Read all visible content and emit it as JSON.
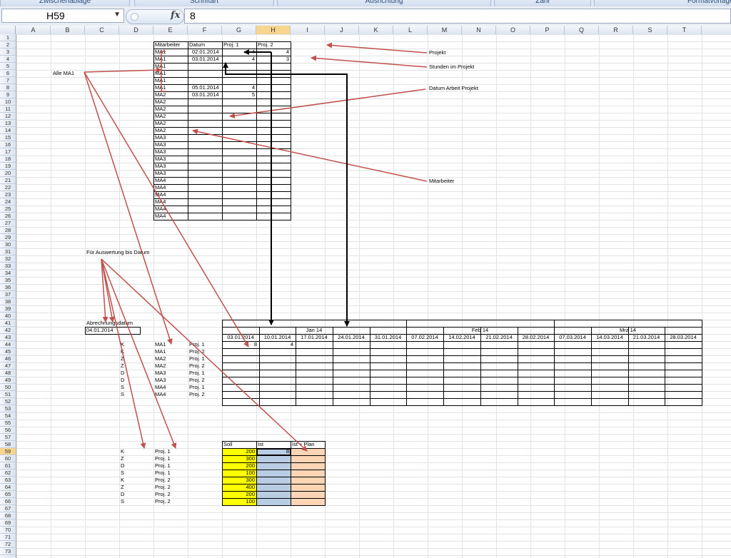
{
  "ribbon": {
    "groups": [
      "Zwischenablage",
      "Schriftart",
      "Ausrichtung",
      "Zahl",
      "Formatvorlagen"
    ]
  },
  "formula_bar": {
    "name_box": "H59",
    "fx_label": "fx",
    "value": "8"
  },
  "columns": [
    "A",
    "B",
    "C",
    "D",
    "E",
    "F",
    "G",
    "H",
    "I",
    "J",
    "K",
    "L",
    "M",
    "N",
    "O",
    "P",
    "Q",
    "R",
    "S",
    "T"
  ],
  "active_column": "H",
  "active_row": 59,
  "rows": 73,
  "top_table": {
    "headers": [
      "Mitarbeiter",
      "Datum",
      "Proj. 1",
      "Proj. 2"
    ],
    "rows": [
      [
        "MA1",
        "02.01.2014",
        "4",
        "4"
      ],
      [
        "MA1",
        "03.01.2014",
        "4",
        "3"
      ],
      [
        "MA1",
        "",
        "",
        ""
      ],
      [
        "MA1",
        "",
        "",
        ""
      ],
      [
        "MA1",
        "",
        "",
        ""
      ],
      [
        "MA1",
        "05.01.2014",
        "4",
        ""
      ],
      [
        "MA2",
        "03.01.2014",
        "5",
        ""
      ],
      [
        "MA2",
        "",
        "",
        ""
      ],
      [
        "MA2",
        "",
        "",
        ""
      ],
      [
        "MA2",
        "",
        "",
        ""
      ],
      [
        "MA2",
        "",
        "",
        ""
      ],
      [
        "MA2",
        "",
        "",
        ""
      ],
      [
        "MA3",
        "",
        "",
        ""
      ],
      [
        "MA3",
        "",
        "",
        ""
      ],
      [
        "MA3",
        "",
        "",
        ""
      ],
      [
        "MA3",
        "",
        "",
        ""
      ],
      [
        "MA3",
        "",
        "",
        ""
      ],
      [
        "MA3",
        "",
        "",
        ""
      ],
      [
        "MA4",
        "",
        "",
        ""
      ],
      [
        "MA4",
        "",
        "",
        ""
      ],
      [
        "MA4",
        "",
        "",
        ""
      ],
      [
        "MA4",
        "",
        "",
        ""
      ],
      [
        "MA4",
        "",
        "",
        ""
      ],
      [
        "MA4",
        "",
        "",
        ""
      ]
    ]
  },
  "annotations": {
    "projekt": "Projekt",
    "stunden": "Stunden im Projekt",
    "datum_arbeit": "Datum Arbeit Projekt",
    "mitarbeiter": "Mitarbeiter",
    "alle_ma1": "Alle MA1",
    "fuer_auswertung": "Für Auswertung bis Datum"
  },
  "abrechnung": {
    "label": "Abrechnungsdatum",
    "value": "04.01.2014"
  },
  "mid_table": {
    "months": [
      "Jan 14",
      "Feb 14",
      "Mrz 14"
    ],
    "dates": [
      "03.01.2014",
      "10.01.2014",
      "17.01.2014",
      "24.01.2014",
      "31.01.2014",
      "07.02.2014",
      "14.02.2014",
      "21.02.2014",
      "28.02.2014",
      "07.03.2014",
      "14.03.2014",
      "21.03.2014",
      "28.03.2014"
    ],
    "row_values": [
      [
        "8",
        "4"
      ]
    ],
    "labels": [
      [
        "K",
        "MA1",
        "Proj. 1"
      ],
      [
        "K",
        "MA1",
        "Proj. 2"
      ],
      [
        "Z",
        "MA2",
        "Proj. 1"
      ],
      [
        "Z",
        "MA2",
        "Proj. 2"
      ],
      [
        "D",
        "MA3",
        "Proj. 1"
      ],
      [
        "D",
        "MA3",
        "Proj. 2"
      ],
      [
        "S",
        "MA4",
        "Proj. 1"
      ],
      [
        "S",
        "MA4",
        "Proj. 2"
      ]
    ]
  },
  "bottom_table": {
    "headers": [
      "Soll",
      "Ist",
      "Ist + Plan"
    ],
    "rows": [
      [
        "K",
        "Proj. 1",
        "200",
        "8"
      ],
      [
        "Z",
        "Proj. 1",
        "300",
        ""
      ],
      [
        "D",
        "Proj. 1",
        "200",
        ""
      ],
      [
        "S",
        "Proj. 1",
        "100",
        ""
      ],
      [
        "K",
        "Proj. 2",
        "300",
        ""
      ],
      [
        "Z",
        "Proj. 2",
        "400",
        ""
      ],
      [
        "D",
        "Proj. 2",
        "200",
        ""
      ],
      [
        "S",
        "Proj. 2",
        "100",
        ""
      ]
    ],
    "colors": {
      "soll": "#ffff00",
      "ist": "#b8cce4",
      "plan": "#fcd5b4"
    }
  }
}
